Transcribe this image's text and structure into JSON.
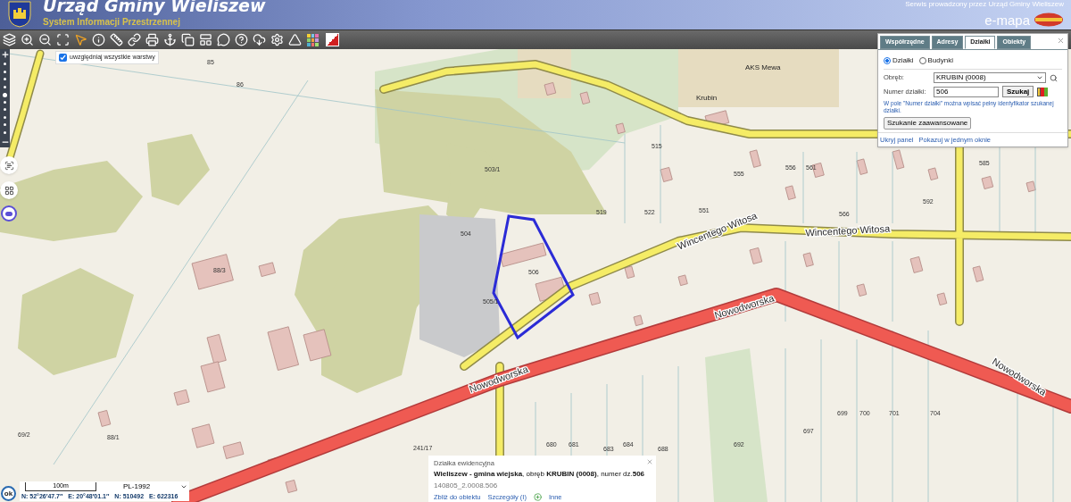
{
  "header": {
    "title": "Urząd Gminy Wieliszew",
    "subtitle": "System Informacji Przestrzennej",
    "service_note": "Serwis prowadzony przez Urząd Gminy Wieliszew",
    "brand": "e-mapa"
  },
  "layers_checkbox": {
    "label": "uwzględniaj wszystkie warstwy",
    "checked": true
  },
  "zoom_slider": {
    "level": 0.55
  },
  "search_panel": {
    "tabs": [
      {
        "label": "Współrzędne",
        "selected": false
      },
      {
        "label": "Adresy",
        "selected": false
      },
      {
        "label": "Działki",
        "selected": true
      },
      {
        "label": "Obiekty",
        "selected": false
      }
    ],
    "radios": [
      {
        "label": "Działki",
        "selected": true
      },
      {
        "label": "Budynki",
        "selected": false
      }
    ],
    "precinct_label": "Obręb:",
    "precinct_value": "KRUBIN (0008)",
    "parcel_label": "Numer działki:",
    "parcel_value": "506",
    "search_button": "Szukaj",
    "hint": "W pole \"Numer działki\" można wpisać pełny identyfikator szukanej działki.",
    "advanced_button": "Szukanie zaawansowane",
    "links": [
      "Ukryj panel",
      "Pokazuj w jednym oknie"
    ]
  },
  "popup": {
    "title": "Działka ewidencyjna",
    "description": "**Wieliszew - gmina wiejska**, obręb **KRUBIN (0008)**, numer dz.**506**",
    "id": "140805_2.0008.506",
    "links": [
      "Zbliż do obiektu",
      "Szczegóły (I)",
      "Inne"
    ]
  },
  "status": {
    "ok": "ok",
    "scale": "100m",
    "crs": "PL-1992",
    "coords": [
      "N: 52°26′47.7″",
      "E: 20°48′01.1″",
      "N: 510492",
      "E: 622316"
    ]
  },
  "map": {
    "street_labels": [
      "Nowodworska",
      "Nowodworska",
      "Nowodworska",
      "Wincentego Witosa",
      "Wincentego Witosa"
    ],
    "place_labels": [
      "AKS Mewa",
      "Krubin"
    ],
    "parcel_labels": [
      "85",
      "86",
      "503/1",
      "504",
      "505/1",
      "506",
      "88/3",
      "88/1",
      "69/2",
      "241/17",
      "680",
      "681",
      "683",
      "684",
      "688",
      "692",
      "697",
      "699",
      "700",
      "701",
      "704",
      "515",
      "519",
      "522",
      "551",
      "555",
      "556",
      "561",
      "566",
      "585",
      "592"
    ]
  }
}
